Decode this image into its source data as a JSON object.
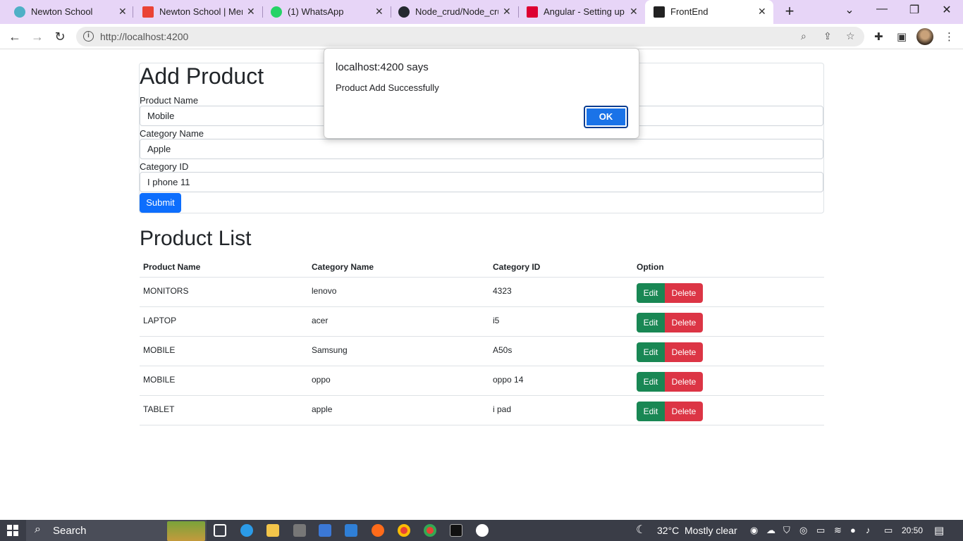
{
  "browser": {
    "tabs": [
      {
        "title": "Newton School",
        "icon": "newton-icon",
        "color": "#4fb0c6"
      },
      {
        "title": "Newton School | Ment",
        "icon": "gmail-icon",
        "color": "#ea4335"
      },
      {
        "title": "(1) WhatsApp",
        "icon": "whatsapp-icon",
        "color": "#25d366"
      },
      {
        "title": "Node_crud/Node_cruc",
        "icon": "github-icon",
        "color": "#24292f"
      },
      {
        "title": "Angular - Setting up t",
        "icon": "angular-icon",
        "color": "#dd0031"
      },
      {
        "title": "FrontEnd",
        "icon": "angular-icon",
        "color": "#222"
      }
    ],
    "url": "http://localhost:4200"
  },
  "dialog": {
    "title": "localhost:4200 says",
    "message": "Product Add Successfully",
    "ok_label": "OK"
  },
  "form": {
    "title": "Add Product",
    "fields": [
      {
        "label": "Product Name",
        "value": "Mobile"
      },
      {
        "label": "Category Name",
        "value": "Apple"
      },
      {
        "label": "Category ID",
        "value": "I phone 11"
      }
    ],
    "submit_label": "Submit"
  },
  "list": {
    "title": "Product List",
    "headers": [
      "Product Name",
      "Category Name",
      "Category ID",
      "Option"
    ],
    "rows": [
      [
        "MONITORS",
        "lenovo",
        "4323"
      ],
      [
        "LAPTOP",
        "acer",
        "i5"
      ],
      [
        "MOBILE",
        "Samsung",
        "A50s"
      ],
      [
        "MOBILE",
        "oppo",
        "oppo 14"
      ],
      [
        "TABLET",
        "apple",
        "i pad"
      ]
    ],
    "edit_label": "Edit",
    "delete_label": "Delete"
  },
  "taskbar": {
    "search_placeholder": "Search",
    "temperature": "32°C",
    "weather": "Mostly clear",
    "time": "20:50"
  },
  "colors": {
    "primary": "#0d6efd",
    "success": "#198754",
    "danger": "#dc3545",
    "tab_strip": "#e7d5f7",
    "taskbar": "#3a3d47"
  }
}
